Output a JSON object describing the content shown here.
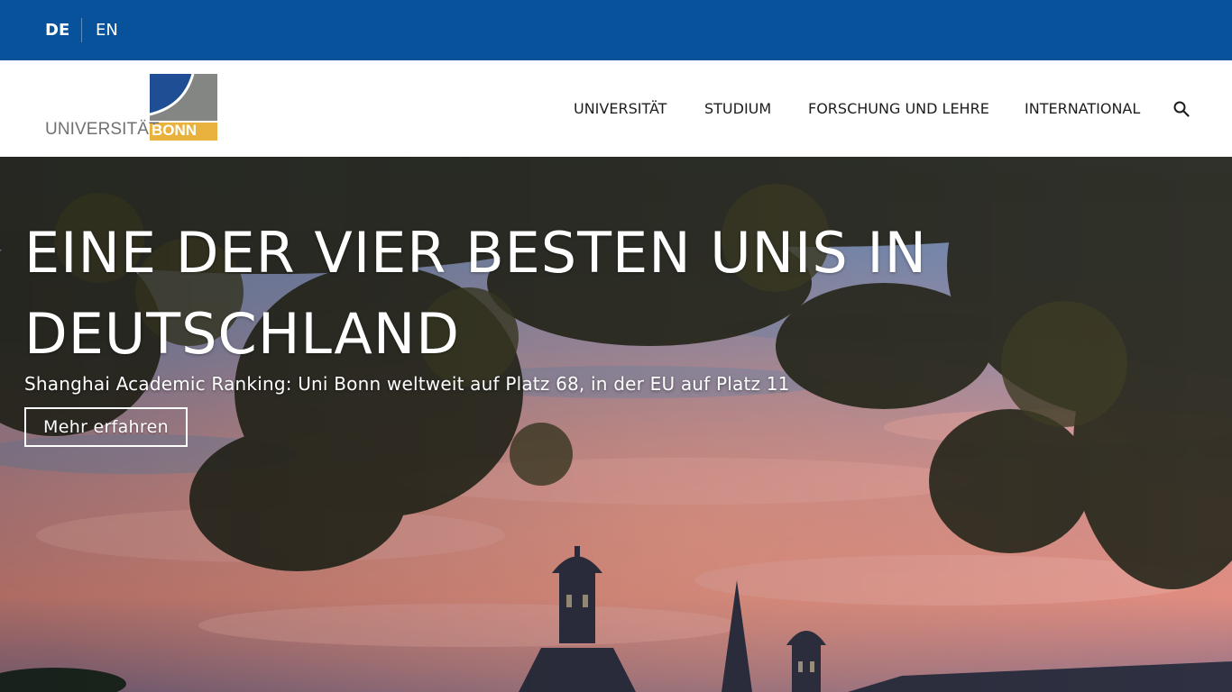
{
  "language_bar": {
    "active": "DE",
    "languages": [
      "DE",
      "EN"
    ],
    "background_color": "#07529a"
  },
  "logo": {
    "word": "UNIVERSITÄT",
    "highlight": "BONN",
    "colors": {
      "blue": "#1f4e95",
      "grey": "#848683",
      "gold": "#e9b23c",
      "text": "#707173"
    }
  },
  "nav": {
    "items": [
      "UNIVERSITÄT",
      "STUDIUM",
      "FORSCHUNG UND LEHRE",
      "INTERNATIONAL"
    ],
    "search_icon": "search-icon"
  },
  "hero": {
    "title": "EINE DER VIER BESTEN UNIS IN DEUTSCHLAND",
    "subtitle": "Shanghai Academic Ranking: Uni Bonn weltweit auf Platz 68, in der EU auf Platz 11",
    "button_label": "Mehr erfahren"
  }
}
